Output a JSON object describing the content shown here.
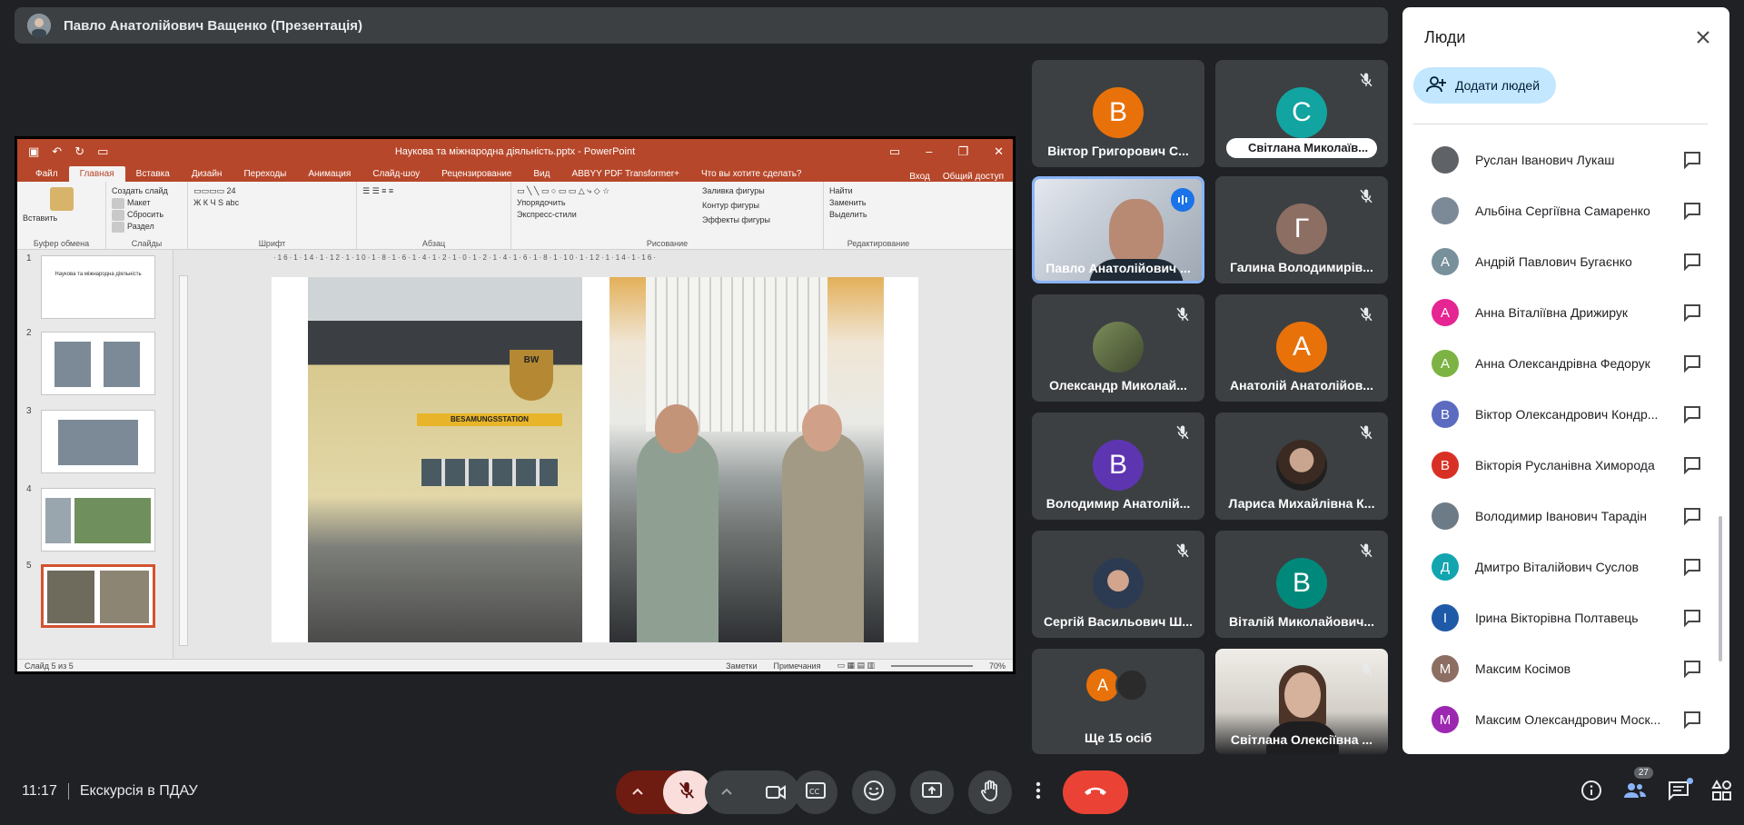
{
  "presenter": {
    "name": "Павло Анатолійович Ващенко (Презентація)"
  },
  "powerpoint": {
    "title": "Наукова та міжнародна діяльність.pptx - PowerPoint",
    "tabs": [
      "Файл",
      "Главная",
      "Вставка",
      "Дизайн",
      "Переходы",
      "Анимация",
      "Слайд-шоу",
      "Рецензирование",
      "Вид",
      "ABBYY PDF Transformer+",
      "Что вы хотите сделать?"
    ],
    "tabs_right": [
      "Вход",
      "Общий доступ"
    ],
    "ribbon": {
      "clipboard": "Буфер обмена",
      "paste": "Вставить",
      "slides": "Слайды",
      "new_slide": "Создать слайд",
      "layout": "Макет",
      "reset": "Сбросить",
      "section": "Раздел",
      "font": "Шрифт",
      "font_size": "24",
      "paragraph": "Абзац",
      "drawing": "Рисование",
      "arrange": "Упорядочить",
      "quick_styles": "Экспресс-стили",
      "shape_fill": "Заливка фигуры",
      "shape_outline": "Контур фигуры",
      "shape_effects": "Эффекты фигуры",
      "editing": "Редактирование",
      "find": "Найти",
      "replace": "Заменить",
      "select": "Выделить"
    },
    "thumbnails": [
      {
        "num": "1",
        "text": "Наукова та міжнародна діяльність"
      },
      {
        "num": "2",
        "text": ""
      },
      {
        "num": "3",
        "text": ""
      },
      {
        "num": "4",
        "text": ""
      },
      {
        "num": "5",
        "text": ""
      }
    ],
    "ruler": "·16·1·14·1·12·1·10·1·8·1·6·1·4·1·2·1·0·1·2·1·4·1·6·1·8·1·10·1·12·1·14·1·16·",
    "slide": {
      "sign_text": "BESAMUNGSSTATION",
      "logo_text": "BW"
    },
    "status": {
      "slide_of": "Слайд 5 из 5",
      "notes": "Заметки",
      "comments": "Примечания",
      "zoom": "70%"
    }
  },
  "tiles": [
    {
      "name": "Віктор Григорович С...",
      "initial": "В",
      "color": "#e8710a",
      "muted": false
    },
    {
      "name": "Світлана Миколаїв...",
      "initial": "С",
      "color": "#12a4a0",
      "muted": true
    },
    {
      "name": "Павло Анатолійович ...",
      "initial": "",
      "color": "",
      "muted": false
    },
    {
      "name": "Галина Володимирів...",
      "initial": "Г",
      "color": "#8d6e63",
      "muted": true
    },
    {
      "name": "Олександр Миколай...",
      "initial": "",
      "color": "",
      "muted": true
    },
    {
      "name": "Анатолій Анатолійов...",
      "initial": "А",
      "color": "#e8710a",
      "muted": true
    },
    {
      "name": "Володимир Анатолій...",
      "initial": "В",
      "color": "#5e35b1",
      "muted": true
    },
    {
      "name": "Лариса Михайлівна К...",
      "initial": "",
      "color": "",
      "muted": true
    },
    {
      "name": "Сергій Васильович Ш...",
      "initial": "",
      "color": "",
      "muted": true
    },
    {
      "name": "Віталій Миколайович...",
      "initial": "В",
      "color": "#00897b",
      "muted": true
    },
    {
      "name": "Ще 15 осіб",
      "initial": "А",
      "color": "#e8710a",
      "muted": false
    },
    {
      "name": "Світлана Олексіївна ...",
      "initial": "",
      "color": "",
      "muted": true
    }
  ],
  "people_panel": {
    "title": "Люди",
    "add_people": "Додати людей",
    "list": [
      {
        "name": "Руслан Іванович Лукаш",
        "initial": "",
        "color": "#5f6368"
      },
      {
        "name": "Альбіна Сергіївна Самаренко",
        "initial": "",
        "color": "#7b8a96"
      },
      {
        "name": "Андрій Павлович Бугаєнко",
        "initial": "А",
        "color": "#78909c"
      },
      {
        "name": "Анна Віталіївна Дрижирук",
        "initial": "А",
        "color": "#e52592"
      },
      {
        "name": "Анна Олександрівна Федорук",
        "initial": "А",
        "color": "#7cb342"
      },
      {
        "name": "Віктор Олександрович Кондр...",
        "initial": "В",
        "color": "#5c6bc0"
      },
      {
        "name": "Вікторія Русланівна Химорода",
        "initial": "В",
        "color": "#d93025"
      },
      {
        "name": "Володимир Іванович Тарадін",
        "initial": "",
        "color": "#6d7b86"
      },
      {
        "name": "Дмитро Віталійович Суслов",
        "initial": "Д",
        "color": "#12a4af"
      },
      {
        "name": "Ірина Вікторівна Полтавець",
        "initial": "І",
        "color": "#1e5aa8"
      },
      {
        "name": "Максим Косімов",
        "initial": "М",
        "color": "#8d6e63"
      },
      {
        "name": "Максим Олександрович Моск...",
        "initial": "М",
        "color": "#9c27b0"
      }
    ]
  },
  "bottom": {
    "time": "11:17",
    "meeting": "Екскурсія в ПДАУ",
    "participants_count": "27"
  }
}
